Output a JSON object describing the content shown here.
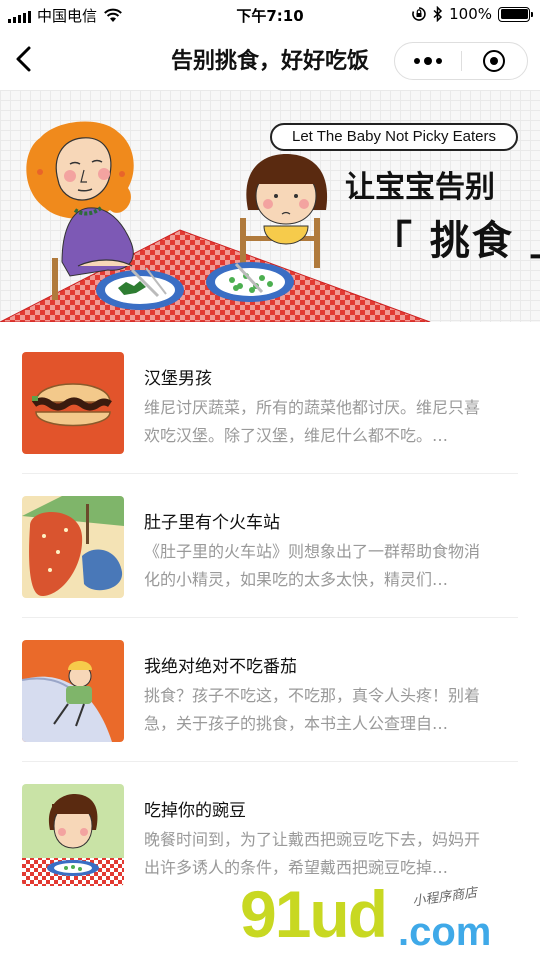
{
  "status_bar": {
    "carrier": "中国电信",
    "time": "下午7:10",
    "battery": "100%",
    "battery_level": 1.0
  },
  "nav": {
    "title": "告别挑食，好好吃饭"
  },
  "banner": {
    "english_tag": "Let The Baby Not Picky Eaters",
    "headline_line1": "让宝宝告别",
    "headline_line2": "「 挑食 」"
  },
  "books": [
    {
      "title": "汉堡男孩",
      "description": "维尼讨厌蔬菜，所有的蔬菜他都讨厌。维尼只喜欢吃汉堡。除了汉堡，维尼什么都不吃。…",
      "cover_color": "#e2542b"
    },
    {
      "title": "肚子里有个火车站",
      "description": "《肚子里的火车站》则想象出了一群帮助食物消化的小精灵，如果吃的太多太快，精灵们…",
      "cover_color": "#d9542f"
    },
    {
      "title": "我绝对绝对不吃番茄",
      "description": "挑食？孩子不吃这，不吃那，真令人头疼！别着急，关于孩子的挑食，本书主人公查理自…",
      "cover_color": "#ea6a2a"
    },
    {
      "title": "吃掉你的豌豆",
      "description": "晚餐时间到，为了让戴西把豌豆吃下去，妈妈开出许多诱人的条件，希望戴西把豌豆吃掉…",
      "cover_color": "#c9e3a6"
    }
  ],
  "watermark": {
    "brand": "91ud",
    "suffix": ".com",
    "tagline": "小程序商店"
  }
}
